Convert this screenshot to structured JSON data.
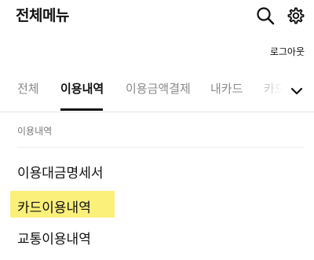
{
  "header": {
    "title": "전체메뉴",
    "icons": [
      "search-icon",
      "gear-icon"
    ]
  },
  "account": {
    "logout_label": "로그아웃"
  },
  "tabs": {
    "items": [
      {
        "label": "전체",
        "active": false
      },
      {
        "label": "이용내역",
        "active": true
      },
      {
        "label": "이용금액결제",
        "active": false
      },
      {
        "label": "내카드",
        "active": false
      },
      {
        "label": "카드",
        "active": false
      }
    ],
    "more_icon": "chevron-down-icon"
  },
  "section": {
    "label": "이용내역",
    "items": [
      {
        "label": "이용대금명세서",
        "highlighted": false
      },
      {
        "label": "카드이용내역",
        "highlighted": true
      },
      {
        "label": "교통이용내역",
        "highlighted": false
      }
    ]
  },
  "colors": {
    "highlight": "#fbf07a",
    "active_tab": "#111111",
    "inactive_tab": "#8a8a8a"
  }
}
